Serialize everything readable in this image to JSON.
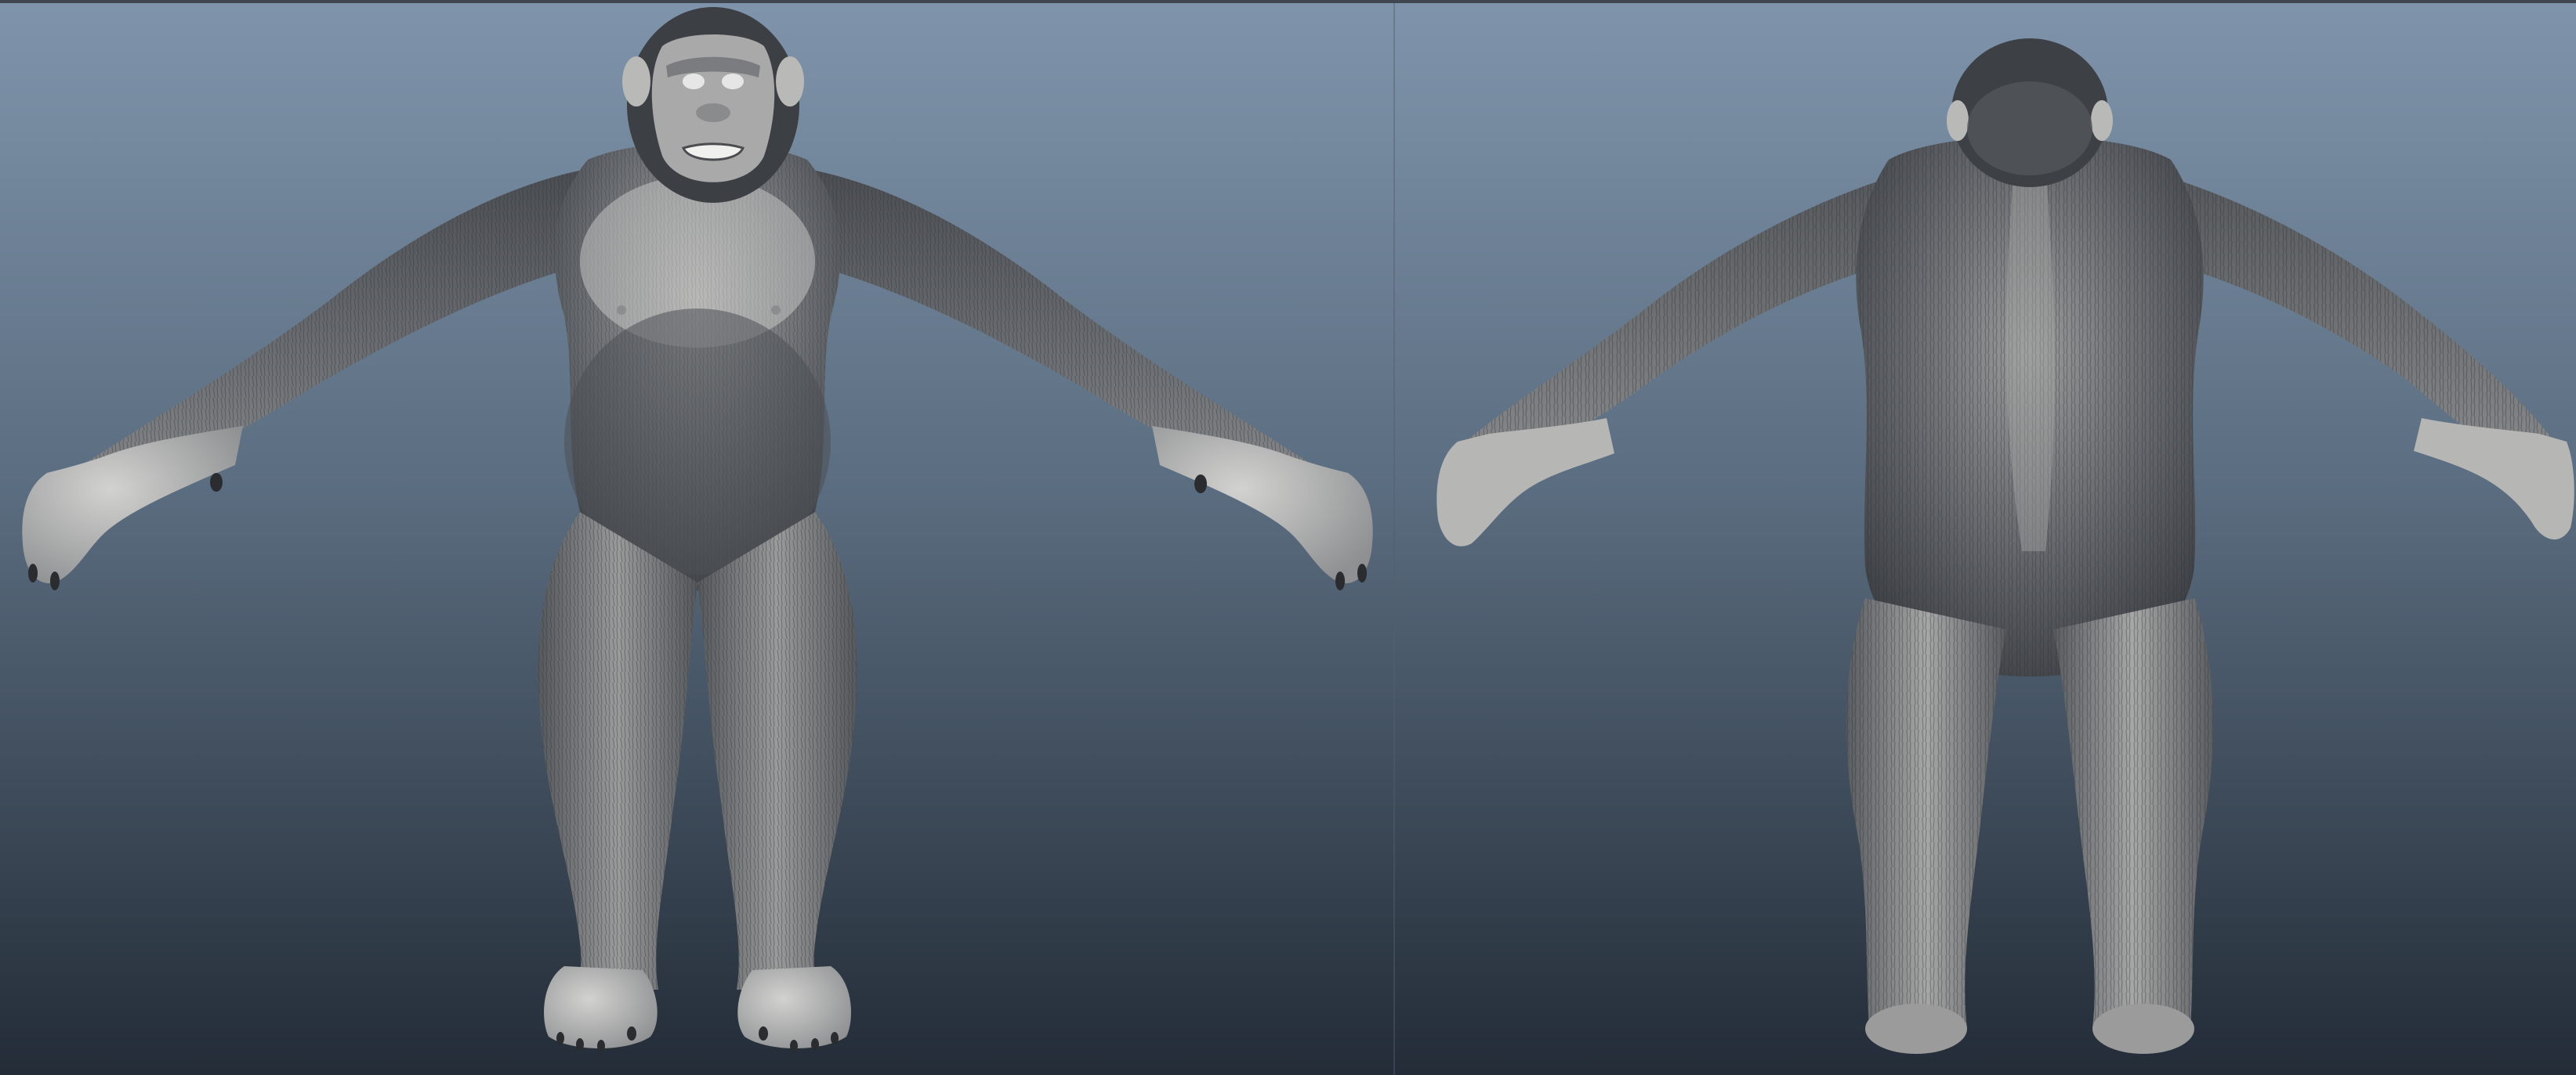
{
  "scene": {
    "background_top": "#7f94ab",
    "background_bottom": "#242d38",
    "fur_dark": "#3a3d42",
    "fur_mid": "#6e7175",
    "fur_light": "#b8b8b6",
    "skin": "#bdbdbb",
    "nails": "#2a2c30"
  },
  "viewports": [
    {
      "view": "front",
      "subject": "chimpanzee-model"
    },
    {
      "view": "back",
      "subject": "chimpanzee-model"
    }
  ]
}
